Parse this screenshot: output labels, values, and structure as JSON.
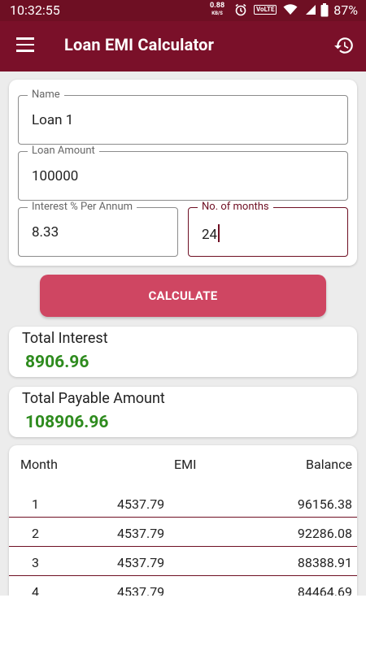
{
  "status": {
    "time": "10:32:55",
    "speed_value": "0.88",
    "speed_unit": "KB/S",
    "volte": "VoLTE",
    "battery": "87%"
  },
  "appbar": {
    "title": "Loan EMI Calculator",
    "menu_icon": "hamburger-menu-icon",
    "history_icon": "history-icon"
  },
  "form": {
    "name": {
      "label": "Name",
      "value": "Loan 1"
    },
    "amount": {
      "label": "Loan Amount",
      "value": "100000"
    },
    "interest": {
      "label": "Interest % Per Annum",
      "value": "8.33"
    },
    "months": {
      "label": "No. of months",
      "value": "24"
    }
  },
  "calculate_button": "CALCULATE",
  "results": {
    "total_interest": {
      "label": "Total Interest",
      "value": "8906.96"
    },
    "total_payable": {
      "label": "Total Payable Amount",
      "value": "108906.96"
    }
  },
  "table": {
    "headers": {
      "month": "Month",
      "emi": "EMI",
      "balance": "Balance"
    },
    "rows": [
      {
        "month": "1",
        "emi": "4537.79",
        "balance": "96156.38"
      },
      {
        "month": "2",
        "emi": "4537.79",
        "balance": "92286.08"
      },
      {
        "month": "3",
        "emi": "4537.79",
        "balance": "88388.91"
      },
      {
        "month": "4",
        "emi": "4537.79",
        "balance": "84464.69"
      }
    ]
  },
  "colors": {
    "primary": "#7a1029",
    "status_bar": "#6e0f23",
    "accent_button": "#cf4662",
    "result_green": "#2e8b1e",
    "background": "#ececec"
  }
}
